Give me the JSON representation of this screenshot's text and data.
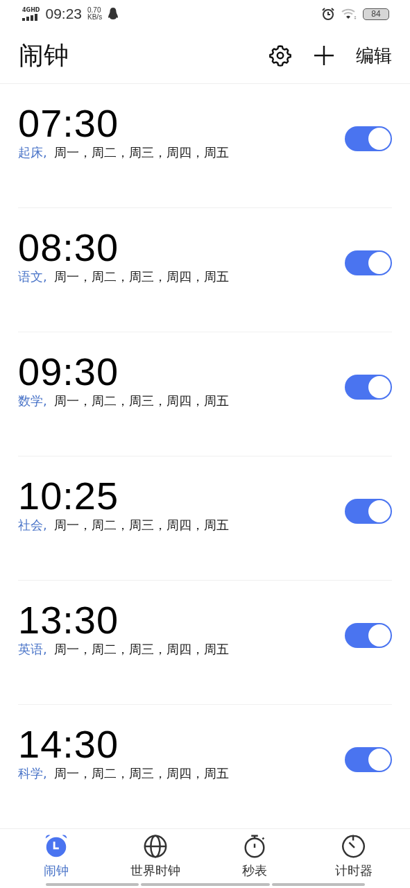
{
  "status_bar": {
    "network": "4GHD",
    "time": "09:23",
    "speed": "0.70",
    "speed_unit": "KB/s",
    "battery": "84"
  },
  "header": {
    "title": "闹钟",
    "action": "编辑"
  },
  "alarms": [
    {
      "time": "07:30",
      "label": "起床,",
      "days": "周一，周二，周三，周四，周五",
      "on": true
    },
    {
      "time": "08:30",
      "label": "语文,",
      "days": "周一，周二，周三，周四，周五",
      "on": true
    },
    {
      "time": "09:30",
      "label": "数学,",
      "days": "周一，周二，周三，周四，周五",
      "on": true
    },
    {
      "time": "10:25",
      "label": "社会,",
      "days": "周一，周二，周三，周四，周五",
      "on": true
    },
    {
      "time": "13:30",
      "label": "英语,",
      "days": "周一，周二，周三，周四，周五",
      "on": true
    },
    {
      "time": "14:30",
      "label": "科学,",
      "days": "周一，周二，周三，周四，周五",
      "on": true
    }
  ],
  "tabs": [
    {
      "label": "闹钟",
      "kind": "alarm",
      "selected": true
    },
    {
      "label": "世界时钟",
      "kind": "globe",
      "selected": false
    },
    {
      "label": "秒表",
      "kind": "stopwatch",
      "selected": false
    },
    {
      "label": "计时器",
      "kind": "timer",
      "selected": false
    }
  ]
}
